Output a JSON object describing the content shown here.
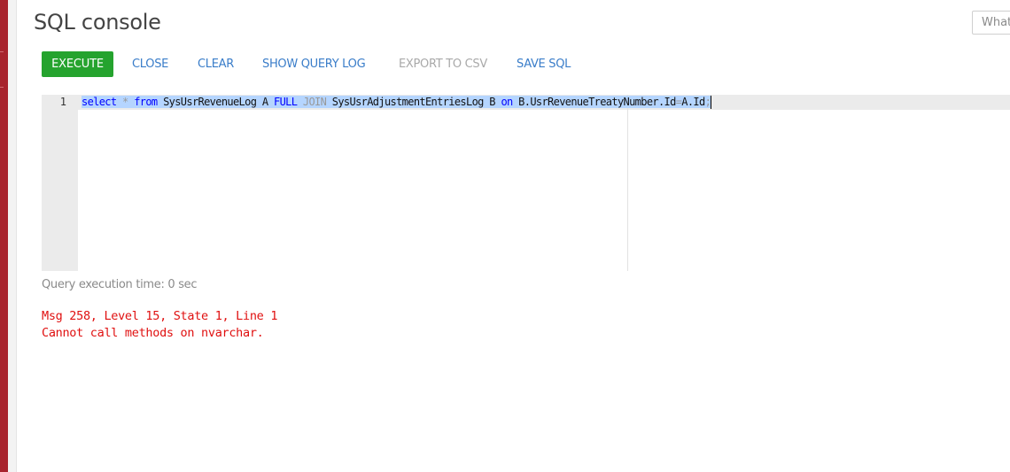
{
  "console": {
    "title": "SQL console",
    "search_placeholder": "What"
  },
  "toolbar": {
    "execute_label": "EXECUTE",
    "close_label": "CLOSE",
    "clear_label": "CLEAR",
    "show_query_log_label": "SHOW QUERY LOG",
    "export_csv_label": "EXPORT TO CSV",
    "save_sql_label": "SAVE SQL"
  },
  "editor": {
    "line_number": "1",
    "tokens": {
      "t1": "select",
      "t2": " ",
      "t3": "*",
      "t4": " ",
      "t5": "from",
      "t6": " SysUsrRevenueLog A ",
      "t7": "FULL",
      "t8": " ",
      "t9": "JOIN",
      "t10": " SysUsrAdjustmentEntriesLog B ",
      "t11": "on",
      "t12": " B.UsrRevenueTreatyNumber.Id",
      "t13": "=",
      "t14": "A.Id",
      "t15": ";"
    }
  },
  "result": {
    "execution_time": "Query execution time: 0 sec",
    "error_line_1": "Msg 258, Level 15, State 1, Line 1",
    "error_line_2": "Cannot call methods on nvarchar."
  },
  "colors": {
    "execute_green": "#25a32e",
    "link_blue": "#3a7dc9",
    "error_red": "#e01010",
    "sidebar_red": "#a8232d",
    "selection_blue": "#b5d5ff"
  }
}
